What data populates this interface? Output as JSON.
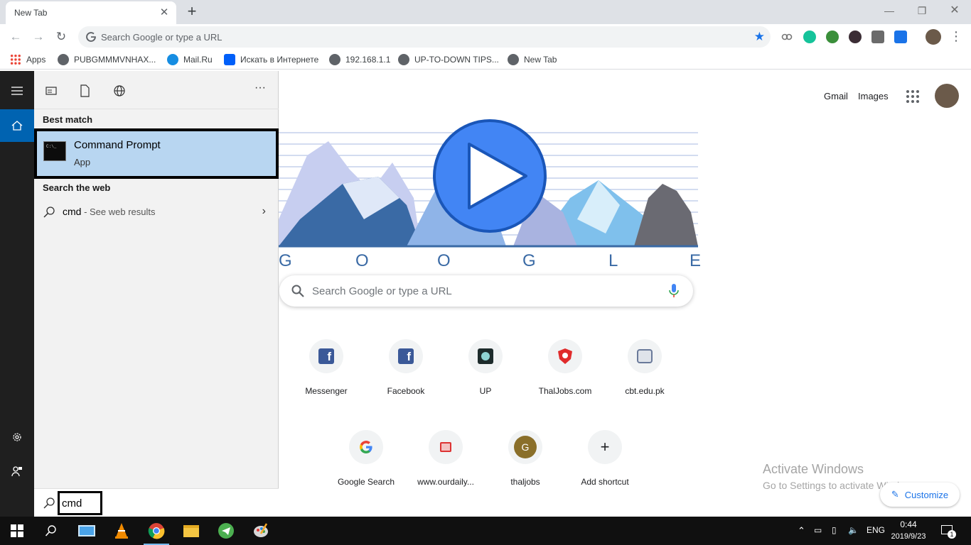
{
  "browser": {
    "tab_title": "New Tab",
    "omnibox_placeholder": "Search Google or type a URL",
    "bookmarks": [
      {
        "label": "Apps",
        "icon": "apps-grid-icon"
      },
      {
        "label": "PUBGMMMVNHAX...",
        "icon": "globe-icon"
      },
      {
        "label": "Mail.Ru",
        "icon": "mailru-icon"
      },
      {
        "label": "Искать в Интернете",
        "icon": "search-bookmark-icon"
      },
      {
        "label": "192.168.1.1",
        "icon": "globe-icon"
      },
      {
        "label": "UP-TO-DOWN TIPS...",
        "icon": "globe-icon"
      },
      {
        "label": "New Tab",
        "icon": "globe-icon"
      }
    ]
  },
  "newtab": {
    "gmail": "Gmail",
    "images": "Images",
    "search_placeholder": "Search Google or type a URL",
    "doodle_letters": [
      "G",
      "O",
      "O",
      "G",
      "L",
      "E"
    ],
    "shortcuts_row1": [
      {
        "label": "Messenger",
        "icon": "facebook-icon"
      },
      {
        "label": "Facebook",
        "icon": "facebook-icon"
      },
      {
        "label": "UP",
        "icon": "up-site-icon"
      },
      {
        "label": "ThalJobs.com",
        "icon": "thaljobs-shield-icon"
      },
      {
        "label": "cbt.edu.pk",
        "icon": "cbt-logo-icon"
      }
    ],
    "shortcuts_row2": [
      {
        "label": "Google Search",
        "icon": "google-g-icon"
      },
      {
        "label": "www.ourdaily...",
        "icon": "ourdaily-icon"
      },
      {
        "label": "thaljobs",
        "icon": "letter-g-avatar-icon",
        "letter": "G"
      },
      {
        "label": "Add shortcut",
        "icon": "plus-icon"
      }
    ],
    "activate_title": "Activate Windows",
    "activate_sub": "Go to Settings to activate Windows.",
    "customize": "Customize"
  },
  "start_menu": {
    "best_match_label": "Best match",
    "best_match_title": "Command Prompt",
    "best_match_sub": "App",
    "search_web_label": "Search the web",
    "web_query": "cmd",
    "web_suffix": " - See web results",
    "search_value": "cmd"
  },
  "taskbar": {
    "language": "ENG",
    "time": "0:44",
    "date": "2019/9/23",
    "notification_count": "1"
  },
  "colors": {
    "highlight": "#b8d6f1",
    "accent_blue": "#1a73e8",
    "start_home": "#0063b1"
  }
}
